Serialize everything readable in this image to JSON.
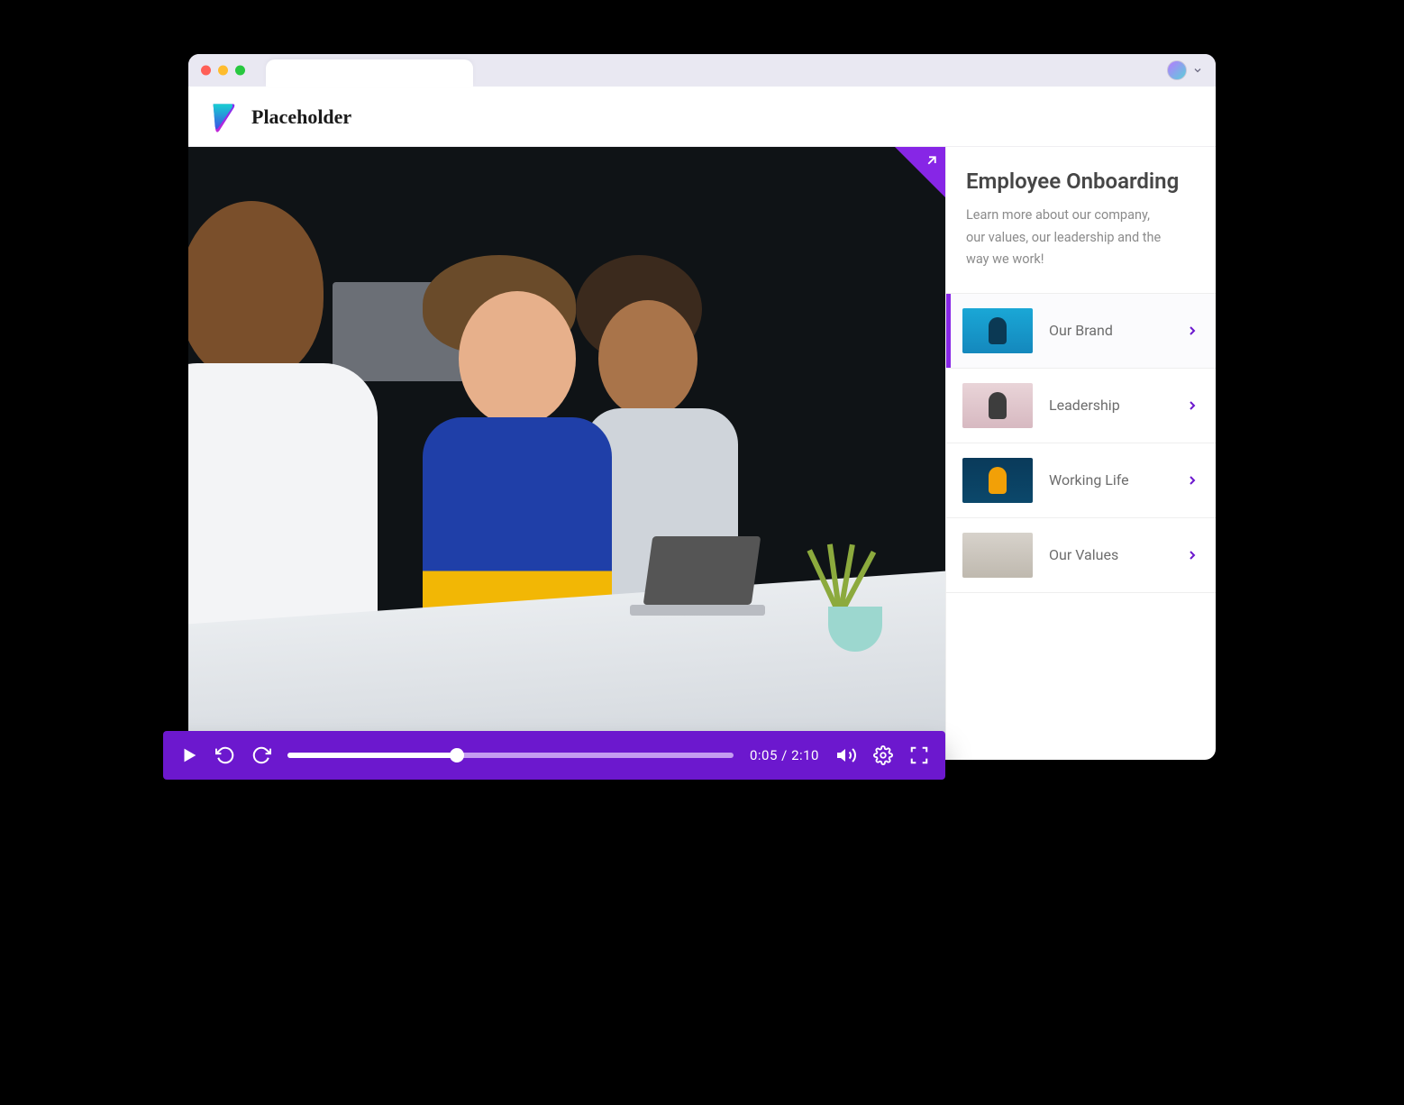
{
  "brand": {
    "name": "Placeholder"
  },
  "video": {
    "time_current": "0:05",
    "time_total": "2:10",
    "progress_percent": 38
  },
  "sidebar": {
    "title": "Employee Onboarding",
    "description": "Learn more about our company, our values, our leadership and the way we work!",
    "items": [
      {
        "label": "Our Brand",
        "active": true
      },
      {
        "label": "Leadership",
        "active": false
      },
      {
        "label": "Working Life",
        "active": false
      },
      {
        "label": "Our Values",
        "active": false
      }
    ]
  },
  "colors": {
    "accent": "#6C18CE"
  }
}
